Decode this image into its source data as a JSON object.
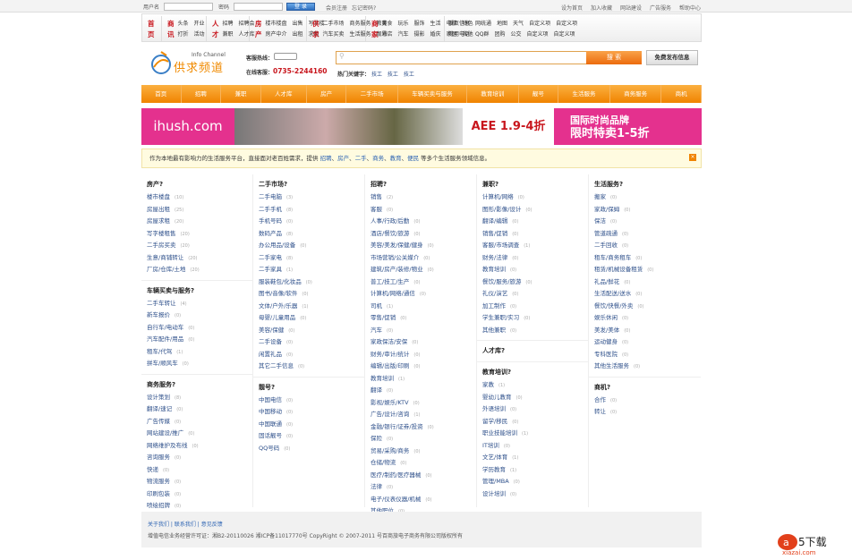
{
  "topbar": {
    "username_label": "用户名",
    "password_label": "密码",
    "login": "登 录",
    "register": "会员注册",
    "forgot": "忘记密码?",
    "links": [
      "设为首页",
      "加入收藏",
      "网站建设",
      "广告服务",
      "帮助中心"
    ]
  },
  "catnav": [
    {
      "big": "首页",
      "rows": []
    },
    {
      "big": "商讯",
      "rows": [
        [
          "头条",
          "开业"
        ],
        [
          "打折",
          "活动"
        ]
      ]
    },
    {
      "big": "人才",
      "rows": [
        [
          "招聘",
          "招聘会"
        ],
        [
          "兼职",
          "人才库"
        ]
      ]
    },
    {
      "big": "房产",
      "rows": [
        [
          "楼市楼盘",
          "出售",
          "写字楼"
        ],
        [
          "房产中介",
          "出租",
          "求租"
        ]
      ]
    },
    {
      "big": "供求",
      "rows": [
        [
          "二手市场",
          "商务服务",
          "教育"
        ],
        [
          "汽车买卖",
          "生活服务",
          "靓号"
        ]
      ]
    },
    {
      "big": "商家",
      "rows": [
        [
          "美食",
          "玩乐",
          "服饰",
          "生活",
          "电脑",
          "特色"
        ],
        [
          "酒店",
          "汽车",
          "摄影",
          "婚庆",
          "家居",
          "其他"
        ]
      ]
    },
    {
      "big": "",
      "rows": [
        [
          "黄页信息",
          "网统通",
          "地图",
          "天气",
          "自定义项",
          "自定义项"
        ],
        [
          "常用电话",
          "QQ群",
          "团购",
          "公交",
          "自定义项",
          "自定义项"
        ]
      ]
    }
  ],
  "header": {
    "logo_title": "供求频道",
    "logo_sub": "Info Channel",
    "hotline_label": "客服热线：",
    "online_label": "在线客服：",
    "online_phone": "0735-2244160",
    "search_placeholder": "",
    "search_button": "搜 索",
    "publish_button": "免费发布信息",
    "hot_label": "热门关键字：",
    "hot_keywords": [
      "技工",
      "技工",
      "技工"
    ]
  },
  "mainnav": [
    "首页",
    "招聘",
    "兼职",
    "人才库",
    "房产",
    "二手市场",
    "车辆买卖与服务",
    "教育培训",
    "靓号",
    "生活服务",
    "商务服务",
    "商机"
  ],
  "banner": {
    "brand": "ihush.com",
    "aee": "AEE 1.9-4折",
    "promo_line1": "国际时尚品牌",
    "promo_line2": "限时特卖1-5折"
  },
  "notice": {
    "prefix": "作为本地最有影响力的生活服务平台，直接面对老百姓需求，提供",
    "links": [
      "招聘",
      "房产",
      "二手",
      "商务",
      "教育",
      "便民"
    ],
    "suffix": "等多个生活服务领域信息。"
  },
  "columns": [
    [
      {
        "title": "房产?",
        "items": [
          [
            "楼市楼盘",
            "(10)"
          ],
          [
            "房屋出租",
            "(25)"
          ],
          [
            "房屋求租",
            "(20)"
          ],
          [
            "写字楼租售",
            "(20)"
          ],
          [
            "二手房买卖",
            "(20)"
          ],
          [
            "生意/商铺转让",
            "(20)"
          ],
          [
            "厂房/仓库/土地",
            "(20)"
          ]
        ]
      },
      {
        "title": "车辆买卖与服务?",
        "items": [
          [
            "二手车转让",
            "(4)"
          ],
          [
            "新车报价",
            "(0)"
          ],
          [
            "自行车/电动车",
            "(0)"
          ],
          [
            "汽车配件/用品",
            "(0)"
          ],
          [
            "租车/代驾",
            "(1)"
          ],
          [
            "拼车/顺风车",
            "(0)"
          ]
        ]
      },
      {
        "title": "商务服务?",
        "items": [
          [
            "设计策划",
            "(8)"
          ],
          [
            "翻译/速记",
            "(0)"
          ],
          [
            "广告传媒",
            "(0)"
          ],
          [
            "网站建设/推广",
            "(0)"
          ],
          [
            "网络维护及布线",
            "(0)"
          ],
          [
            "咨询服务",
            "(0)"
          ],
          [
            "快递",
            "(0)"
          ],
          [
            "物流服务",
            "(0)"
          ],
          [
            "印刷包装",
            "(0)"
          ],
          [
            "喷绘招牌",
            "(0)"
          ],
          [
            "制卡",
            "(0)"
          ]
        ]
      }
    ],
    [
      {
        "title": "二手市场?",
        "items": [
          [
            "二手电脑",
            "(3)"
          ],
          [
            "二手手机",
            "(8)"
          ],
          [
            "手机号码",
            "(0)"
          ],
          [
            "数码产品",
            "(8)"
          ],
          [
            "办公用品/设备",
            "(0)"
          ],
          [
            "二手家电",
            "(8)"
          ],
          [
            "二手家具",
            "(1)"
          ],
          [
            "服装鞋包/化妆品",
            "(0)"
          ],
          [
            "图书/音像/软件",
            "(0)"
          ],
          [
            "文体/户外/乐器",
            "(1)"
          ],
          [
            "母婴/儿童用品",
            "(0)"
          ],
          [
            "美容/保健",
            "(0)"
          ],
          [
            "二手设备",
            "(0)"
          ],
          [
            "闲置礼品",
            "(0)"
          ],
          [
            "其它二手信息",
            "(0)"
          ]
        ]
      },
      {
        "title": "靓号?",
        "items": [
          [
            "中国电信",
            "(0)"
          ],
          [
            "中国移动",
            "(0)"
          ],
          [
            "中国联通",
            "(0)"
          ],
          [
            "固话靓号",
            "(0)"
          ],
          [
            "QQ号码",
            "(0)"
          ]
        ]
      }
    ],
    [
      {
        "title": "招聘?",
        "items": [
          [
            "销售",
            "(2)"
          ],
          [
            "客服",
            "(0)"
          ],
          [
            "人事/行政/后勤",
            "(0)"
          ],
          [
            "酒店/餐饮/旅游",
            "(0)"
          ],
          [
            "美容/美发/保健/健身",
            "(0)"
          ],
          [
            "市场营销/公关媒介",
            "(0)"
          ],
          [
            "建筑/房产/装修/物业",
            "(0)"
          ],
          [
            "普工/技工/生产",
            "(0)"
          ],
          [
            "计算机/网络/通信",
            "(0)"
          ],
          [
            "司机",
            "(1)"
          ],
          [
            "零售/促销",
            "(0)"
          ],
          [
            "汽车",
            "(0)"
          ],
          [
            "家政保洁/安保",
            "(0)"
          ],
          [
            "财务/审计/统计",
            "(0)"
          ],
          [
            "编辑/出版/印刷",
            "(0)"
          ],
          [
            "教育培训",
            "(1)"
          ],
          [
            "翻译",
            "(0)"
          ],
          [
            "影视/娱乐/KTV",
            "(0)"
          ],
          [
            "广告/设计/咨询",
            "(1)"
          ],
          [
            "金融/银行/证券/投资",
            "(0)"
          ],
          [
            "保险",
            "(0)"
          ],
          [
            "贸易/采购/商务",
            "(0)"
          ],
          [
            "仓储/物流",
            "(0)"
          ],
          [
            "医疗/制药/医疗器械",
            "(0)"
          ],
          [
            "法律",
            "(0)"
          ],
          [
            "电子/仪表仪器/机械",
            "(0)"
          ],
          [
            "其他职位",
            "(0)"
          ]
        ]
      }
    ],
    [
      {
        "title": "兼职?",
        "items": [
          [
            "计算机/网络",
            "(0)"
          ],
          [
            "图形/影像/设计",
            "(0)"
          ],
          [
            "翻译/编辑",
            "(0)"
          ],
          [
            "销售/促销",
            "(0)"
          ],
          [
            "客服/市场调查",
            "(1)"
          ],
          [
            "财务/法律",
            "(0)"
          ],
          [
            "教育培训",
            "(0)"
          ],
          [
            "餐饮/服务/旅游",
            "(0)"
          ],
          [
            "礼仪/演艺",
            "(0)"
          ],
          [
            "加工制作",
            "(0)"
          ],
          [
            "学生兼职/实习",
            "(0)"
          ],
          [
            "其他兼职",
            "(0)"
          ]
        ]
      },
      {
        "title": "人才库?",
        "items": []
      },
      {
        "title": "教育培训?",
        "items": [
          [
            "家教",
            "(1)"
          ],
          [
            "婴幼儿教育",
            "(0)"
          ],
          [
            "外语培训",
            "(0)"
          ],
          [
            "留学/移民",
            "(0)"
          ],
          [
            "职业技能培训",
            "(1)"
          ],
          [
            "IT培训",
            "(0)"
          ],
          [
            "文艺/体育",
            "(1)"
          ],
          [
            "学历教育",
            "(1)"
          ],
          [
            "管理/MBA",
            "(0)"
          ],
          [
            "设计培训",
            "(0)"
          ]
        ]
      }
    ],
    [
      {
        "title": "生活服务?",
        "items": [
          [
            "搬家",
            "(0)"
          ],
          [
            "家政/保姆",
            "(0)"
          ],
          [
            "保洁",
            "(0)"
          ],
          [
            "管道疏通",
            "(0)"
          ],
          [
            "二手回收",
            "(0)"
          ],
          [
            "租车/商务租车",
            "(0)"
          ],
          [
            "租赁/机械设备租赁",
            "(0)"
          ],
          [
            "礼品/鲜花",
            "(0)"
          ],
          [
            "生活配送/送水",
            "(0)"
          ],
          [
            "餐饮/快餐/外卖",
            "(0)"
          ],
          [
            "娱乐休闲",
            "(0)"
          ],
          [
            "美发/美体",
            "(0)"
          ],
          [
            "运动健身",
            "(0)"
          ],
          [
            "专科医院",
            "(0)"
          ],
          [
            "其他生活服务",
            "(0)"
          ]
        ]
      },
      {
        "title": "商机?",
        "items": [
          [
            "合作",
            "(0)"
          ],
          [
            "转让",
            "(0)"
          ]
        ]
      }
    ]
  ],
  "footer": {
    "links": [
      "关于我们",
      "联系我们",
      "意见反馈"
    ],
    "copyright": "增值电信业务经营许可证：湘B2-20110026   湘ICP备11017770号  CopyRight © 2007-2011 号百商旅电子商务有限公司版权所有"
  },
  "watermark": "a5下载 xiazai.com",
  "colors": {
    "accent": "#f08300",
    "red": "#c8161d",
    "link": "#2d4f8a",
    "pink": "#e4318e"
  }
}
